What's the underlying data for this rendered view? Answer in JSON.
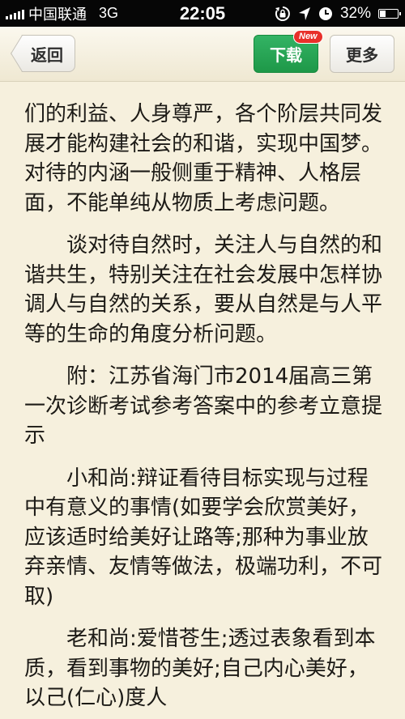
{
  "status_bar": {
    "carrier": "中国联通",
    "network": "3G",
    "time": "22:05",
    "battery_percent": "32%",
    "battery_level": 0.32,
    "icons": [
      "signal-icon",
      "rotation-lock-icon",
      "location-arrow-icon",
      "alarm-clock-icon",
      "battery-icon"
    ]
  },
  "nav": {
    "back_label": "返回",
    "download_label": "下载",
    "new_badge": "New",
    "more_label": "更多",
    "colors": {
      "download": "#1e9848",
      "badge": "#e8302a"
    }
  },
  "article": {
    "paragraphs": [
      "们的利益、人身尊严，各个阶层共同发展才能构建社会的和谐，实现中国梦。对待的内涵一般侧重于精神、人格层面，不能单纯从物质上考虑问题。",
      "谈对待自然时，关注人与自然的和谐共生，特别关注在社会发展中怎样协调人与自然的关系，要从自然是与人平等的生命的角度分析问题。",
      "附：江苏省海门市2014届高三第一次诊断考试参考答案中的参考立意提示",
      "小和尚:辩证看待目标实现与过程中有意义的事情(如要学会欣赏美好，应该适时给美好让路等;那种为事业放弃亲情、友情等做法，极端功利，不可取)",
      "老和尚:爱惜苍生;透过表象看到本质，看到事物的美好;自己内心美好，以己(仁心)度人"
    ]
  }
}
